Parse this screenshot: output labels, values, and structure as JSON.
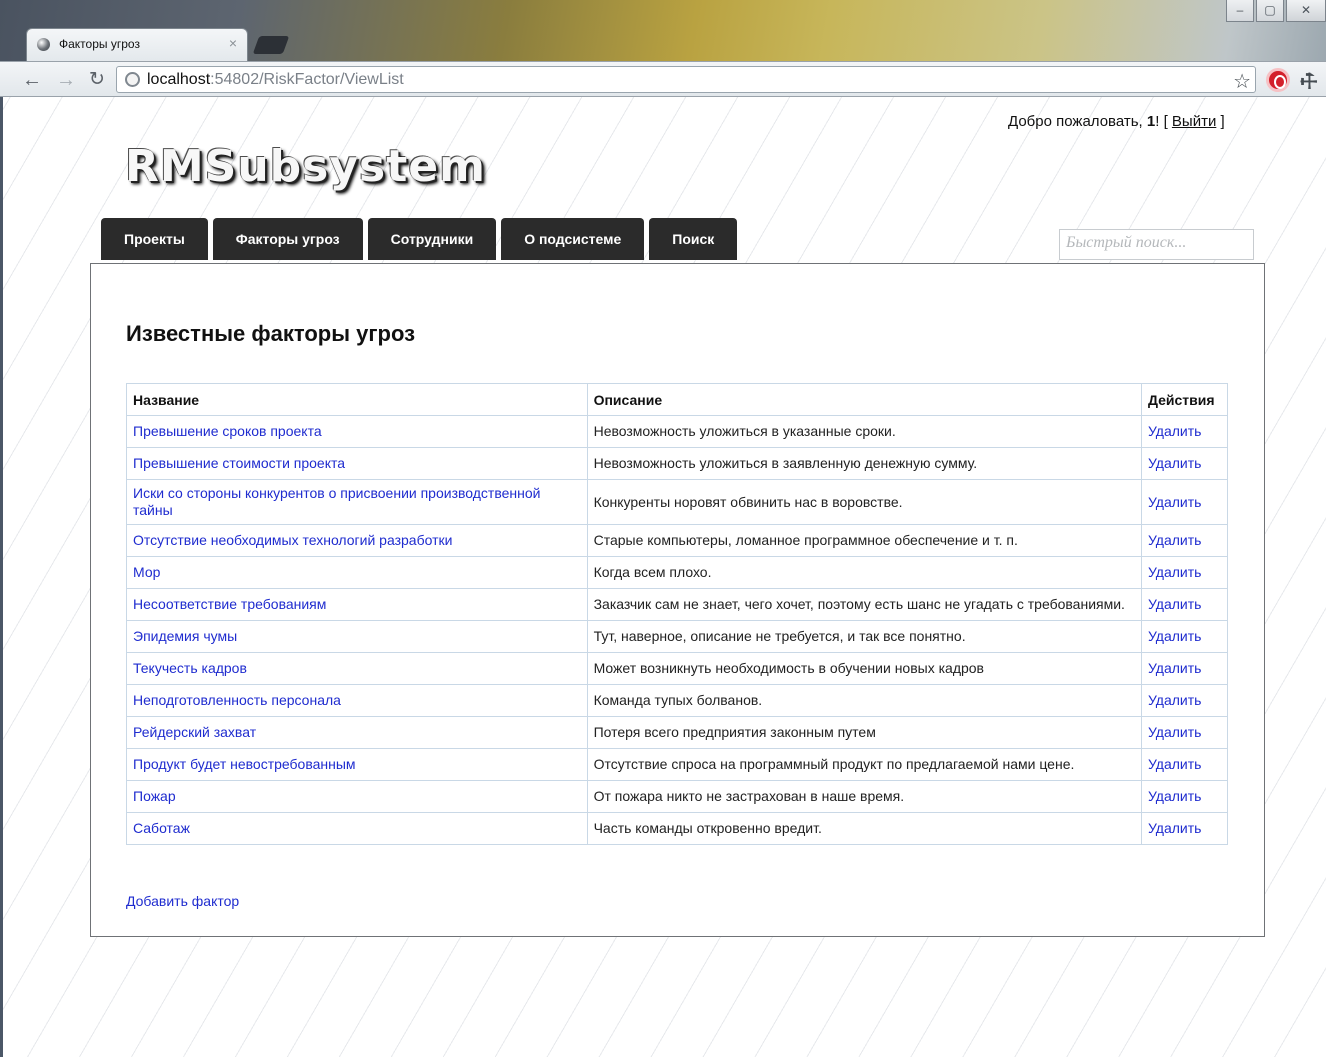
{
  "browser": {
    "tab_title": "Факторы угроз",
    "tab_close": "×",
    "url_host": "localhost",
    "url_rest": ":54802/RiskFactor/ViewList",
    "window_controls": [
      "–",
      "▢",
      "✕"
    ],
    "icons": [
      "back-arrow-icon",
      "forward-arrow-icon",
      "reload-icon",
      "page-icon",
      "star-icon",
      "adblock-icon",
      "wrench-icon"
    ]
  },
  "header": {
    "welcome_prefix": "Добро пожаловать, ",
    "username": "1",
    "welcome_bang": "! [ ",
    "logout": "Выйти",
    "welcome_suffix": " ]",
    "logo": "RMSubsystem",
    "search_placeholder": "Быстрый поиск..."
  },
  "menu": [
    {
      "label": "Проекты"
    },
    {
      "label": "Факторы угроз"
    },
    {
      "label": "Сотрудники"
    },
    {
      "label": "О подсистеме"
    },
    {
      "label": "Поиск"
    }
  ],
  "main": {
    "title": "Известные факторы угроз",
    "columns": [
      "Название",
      "Описание",
      "Действия"
    ],
    "rows": [
      {
        "name": "Превышение сроков проекта",
        "description": "Невозможность уложиться в указанные сроки.",
        "action": "Удалить"
      },
      {
        "name": "Превышение стоимости проекта",
        "description": "Невозможность уложиться в заявленную денежную сумму.",
        "action": "Удалить"
      },
      {
        "name": "Иски со стороны конкурентов о присвоении производственной тайны",
        "description": "Конкуренты норовят обвинить нас в воровстве.",
        "action": "Удалить"
      },
      {
        "name": "Отсутствие необходимых технологий разработки",
        "description": "Старые компьютеры, ломанное программное обеспечение и т. п.",
        "action": "Удалить"
      },
      {
        "name": "Мор",
        "description": "Когда всем плохо.",
        "action": "Удалить"
      },
      {
        "name": "Несоответствие требованиям",
        "description": "Заказчик сам не знает, чего хочет, поэтому есть шанс не угадать с требованиями.",
        "action": "Удалить"
      },
      {
        "name": "Эпидемия чумы",
        "description": "Тут, наверное, описание не требуется, и так все понятно.",
        "action": "Удалить"
      },
      {
        "name": "Текучесть кадров",
        "description": "Может возникнуть необходимость в обучении новых кадров",
        "action": "Удалить"
      },
      {
        "name": "Неподготовленность персонала",
        "description": "Команда тупых болванов.",
        "action": "Удалить"
      },
      {
        "name": "Рейдерский захват",
        "description": "Потеря всего предприятия законным путем",
        "action": "Удалить"
      },
      {
        "name": "Продукт будет невостребованным",
        "description": "Отсутствие спроса на программный продукт по предлагаемой нами цене.",
        "action": "Удалить"
      },
      {
        "name": "Пожар",
        "description": "От пожара никто не застрахован в наше время.",
        "action": "Удалить"
      },
      {
        "name": "Саботаж",
        "description": "Часть команды откровенно вредит.",
        "action": "Удалить"
      }
    ],
    "add_link": "Добавить фактор"
  }
}
